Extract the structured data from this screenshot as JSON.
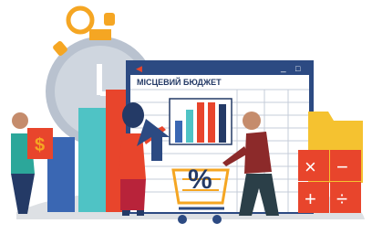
{
  "window": {
    "title": "МІСЦЕВИЙ БЮДЖЕТ",
    "minimize_symbol": "_",
    "maximize_symbol": "□",
    "back_arrow": "◀"
  },
  "money_tile": {
    "symbol": "$"
  },
  "percent_badge": {
    "symbol": "%"
  },
  "calculator": {
    "keys": [
      "×",
      "−",
      "+",
      "÷"
    ]
  },
  "colors": {
    "ground": "#dde0e4",
    "orange": "#f5a623",
    "red": "#e8452c",
    "teal": "#4fc3c5",
    "blue": "#3a67b3",
    "navy": "#243a66",
    "green": "#2ca79a",
    "window_bar": "#2c4a82",
    "clock_face": "#b9c2cf"
  }
}
